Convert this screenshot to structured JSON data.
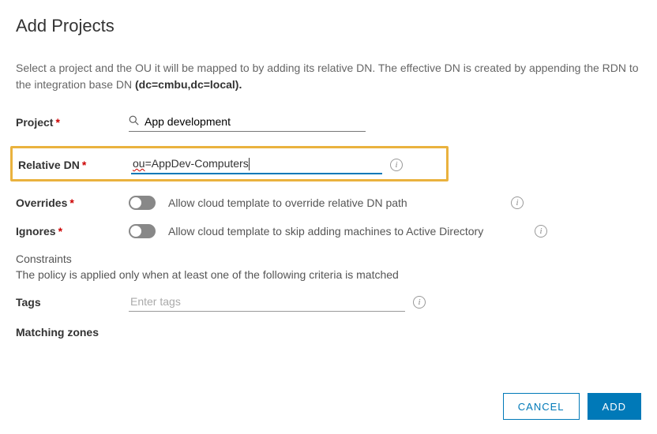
{
  "title": "Add Projects",
  "intro_text": "Select a project and the OU it will be mapped to by adding its relative DN. The effective DN is created by appending the RDN to the integration base DN ",
  "intro_bold": "(dc=cmbu,dc=local).",
  "fields": {
    "project": {
      "label": "Project",
      "value": "App development"
    },
    "relative_dn": {
      "label": "Relative DN",
      "prefix": "ou",
      "suffix": "=AppDev-Computers"
    },
    "overrides": {
      "label": "Overrides",
      "desc": "Allow cloud template to override relative DN path"
    },
    "ignores": {
      "label": "Ignores",
      "desc": "Allow cloud template to skip adding machines to Active Directory"
    }
  },
  "constraints": {
    "title": "Constraints",
    "desc": "The policy is applied only when at least one of the following criteria is matched",
    "tags_label": "Tags",
    "tags_placeholder": "Enter tags",
    "zones_label": "Matching zones"
  },
  "buttons": {
    "cancel": "CANCEL",
    "add": "ADD"
  }
}
